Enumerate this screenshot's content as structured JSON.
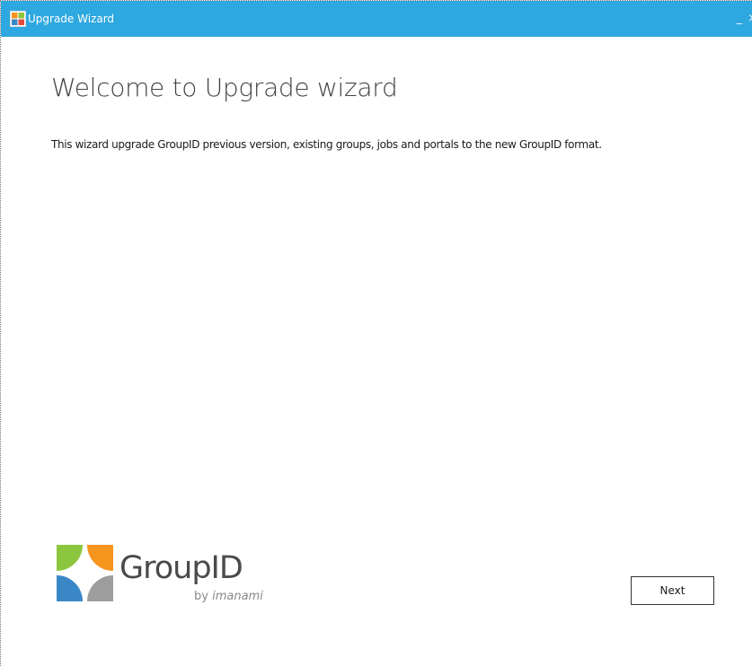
{
  "window": {
    "title": "Upgrade Wizard",
    "minimize_glyph": "_",
    "close_glyph": "×",
    "titlebar_color": "#2ea8e0"
  },
  "main": {
    "heading": "Welcome to Upgrade wizard",
    "description": "This wizard upgrade GroupID previous version, existing groups, jobs and portals to the new GroupID format."
  },
  "logo": {
    "name": "GroupID",
    "by": "by",
    "brand": "imanami",
    "colors": {
      "green": "#8cc63f",
      "orange": "#f7941d",
      "blue": "#3a87c8",
      "gray": "#9d9d9d"
    }
  },
  "footer": {
    "next_label": "Next"
  },
  "icons": {
    "app": "wizard-app-icon",
    "minimize": "minimize-icon",
    "close": "close-icon"
  }
}
